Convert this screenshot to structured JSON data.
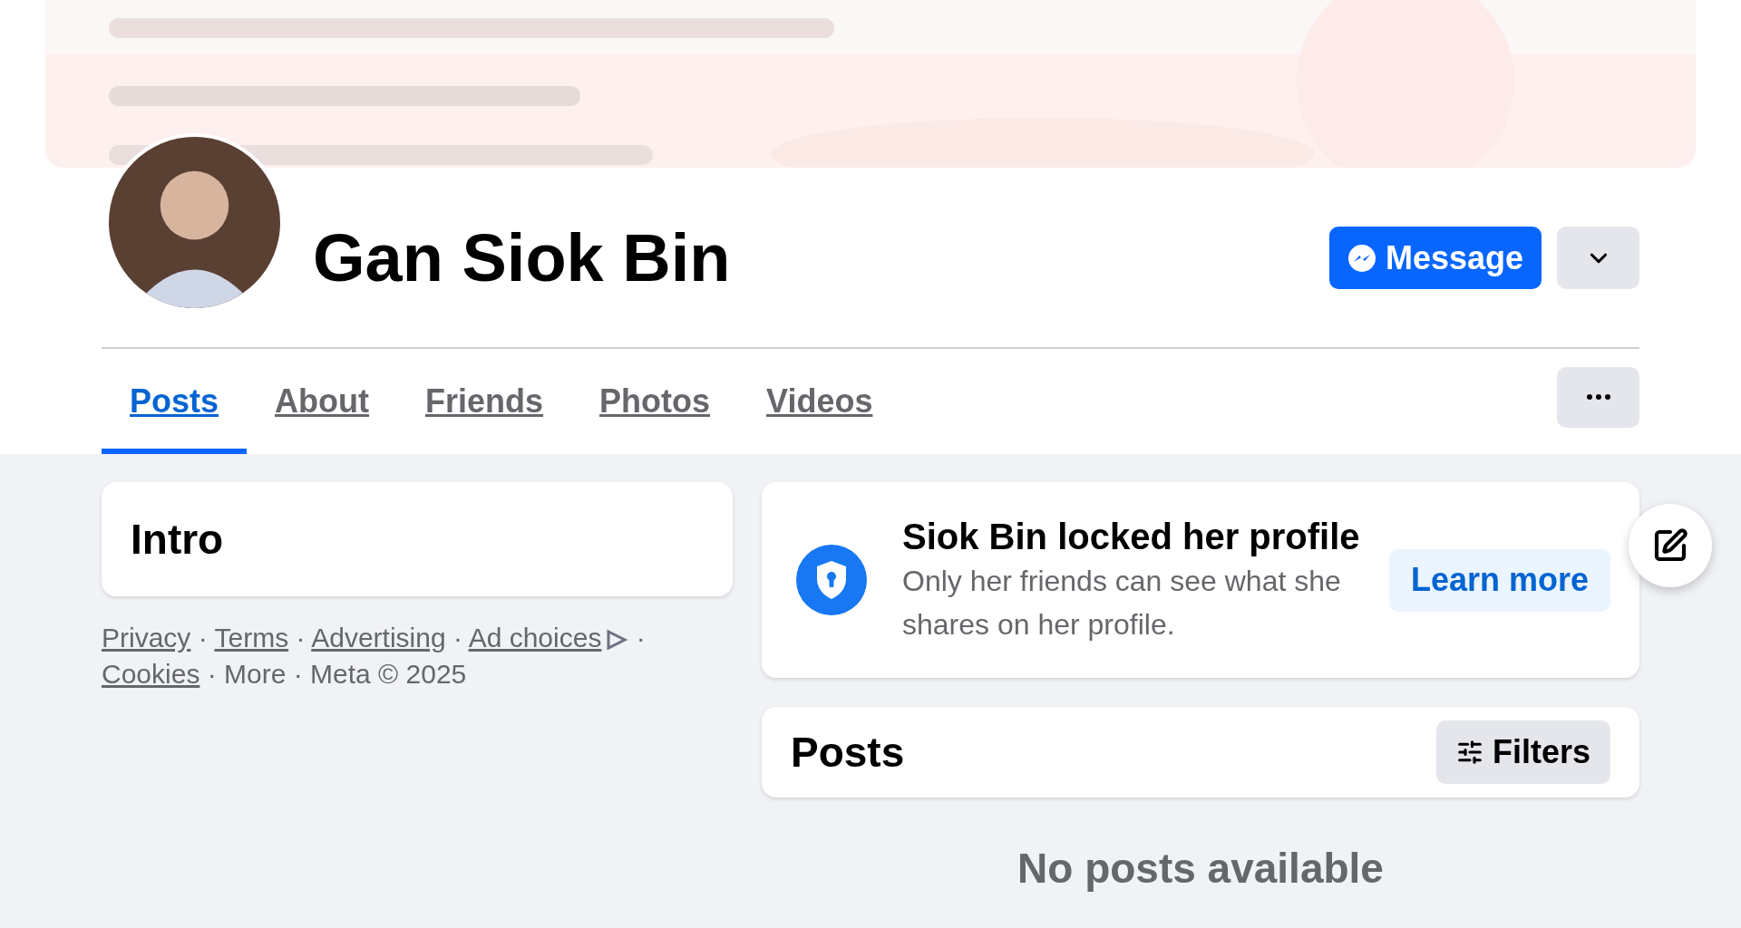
{
  "profile": {
    "name": "Gan Siok Bin",
    "message_button": "Message"
  },
  "tabs": [
    {
      "label": "Posts",
      "selected": true
    },
    {
      "label": "About",
      "selected": false
    },
    {
      "label": "Friends",
      "selected": false
    },
    {
      "label": "Photos",
      "selected": false
    },
    {
      "label": "Videos",
      "selected": false
    }
  ],
  "intro": {
    "title": "Intro"
  },
  "footer": [
    {
      "kind": "link",
      "text": "Privacy"
    },
    {
      "kind": "text",
      "text": "·"
    },
    {
      "kind": "link",
      "text": "Terms"
    },
    {
      "kind": "text",
      "text": "·"
    },
    {
      "kind": "link",
      "text": "Advertising"
    },
    {
      "kind": "text",
      "text": "·"
    },
    {
      "kind": "adlink",
      "text": "Ad choices"
    },
    {
      "kind": "text",
      "text": "·"
    },
    {
      "kind": "link",
      "text": "Cookies"
    },
    {
      "kind": "text",
      "text": "· More · Meta © 2025"
    }
  ],
  "locked_notice": {
    "title": "Siok Bin locked her profile",
    "description": "Only her friends can see what she shares on her profile.",
    "button": "Learn more"
  },
  "posts": {
    "title": "Posts",
    "filters_button": "Filters",
    "empty_message": "No posts available"
  }
}
